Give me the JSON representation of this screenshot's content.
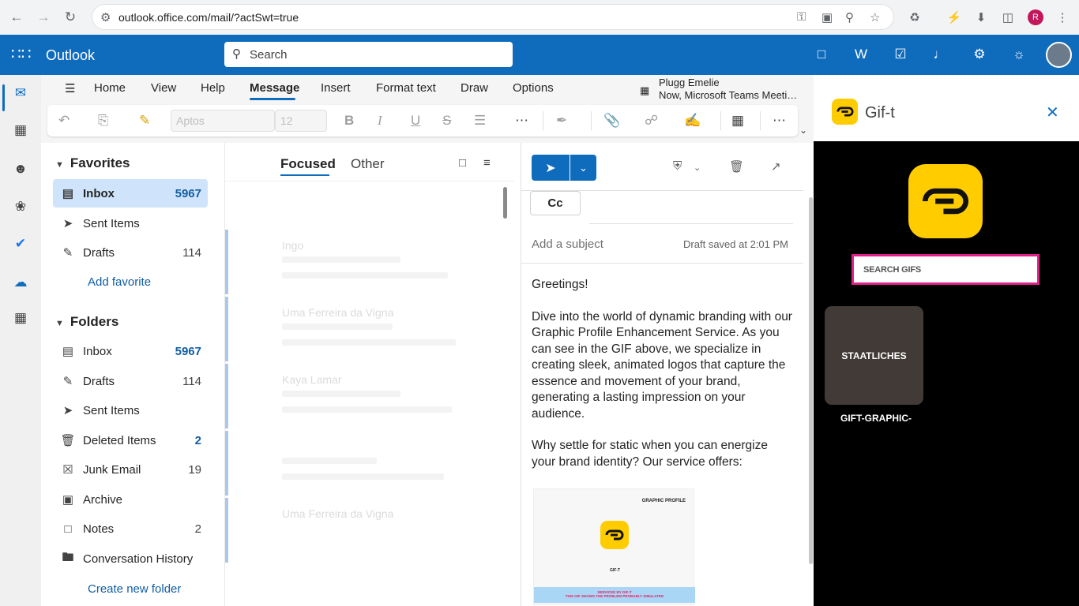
{
  "browser": {
    "url": "outlook.office.com/mail/?actSwt=true",
    "profile_initial": "R"
  },
  "app": {
    "brand": "Outlook",
    "search_placeholder": "Search"
  },
  "ribbon": {
    "tabs": [
      "Home",
      "View",
      "Help",
      "Message",
      "Insert",
      "Format text",
      "Draw",
      "Options"
    ],
    "selected_tab": "Message",
    "font_name": "Aptos",
    "font_size": "12",
    "meeting_title": "Plugg Emelie",
    "meeting_sub": "Now, Microsoft Teams Meeti…"
  },
  "folders": {
    "favorites_label": "Favorites",
    "favorites": [
      {
        "label": "Inbox",
        "count": "5967",
        "icon": "inbox-icon"
      },
      {
        "label": "Sent Items",
        "count": "",
        "icon": "send-icon"
      },
      {
        "label": "Drafts",
        "count": "114",
        "icon": "draft-icon"
      }
    ],
    "add_favorite": "Add favorite",
    "folders_label": "Folders",
    "items": [
      {
        "label": "Inbox",
        "count": "5967",
        "icon": "inbox-icon"
      },
      {
        "label": "Drafts",
        "count": "114",
        "icon": "draft-icon"
      },
      {
        "label": "Sent Items",
        "count": "",
        "icon": "send-icon"
      },
      {
        "label": "Deleted Items",
        "count": "2",
        "icon": "trash-icon"
      },
      {
        "label": "Junk Email",
        "count": "19",
        "icon": "junk-icon"
      },
      {
        "label": "Archive",
        "count": "",
        "icon": "archive-icon"
      },
      {
        "label": "Notes",
        "count": "2",
        "icon": "note-icon"
      },
      {
        "label": "Conversation History",
        "count": "",
        "icon": "folder-icon"
      }
    ],
    "create_folder": "Create new folder"
  },
  "message_list": {
    "tabs": [
      "Focused",
      "Other"
    ],
    "selected": "Focused",
    "faded_senders": [
      "Ingo",
      "Uma Ferreira da Vigna",
      "Kaya Lamar",
      "",
      "Uma Ferreira da Vigna"
    ]
  },
  "compose": {
    "cc_label": "Cc",
    "subject_placeholder": "Add a subject",
    "saved_status": "Draft saved at 2:01 PM",
    "greeting": "Greetings!",
    "paragraph1": "Dive into the world of dynamic branding with our Graphic Profile Enhancement Service. As you can see in the GIF above, we specialize in creating sleek, animated logos that capture the essence and movement of your brand, generating a lasting impression on your audience.",
    "paragraph2": "Why settle for static when you can energize your brand identity? Our service offers:",
    "embed": {
      "header": "GRAPHIC PROFILE",
      "brand": "GIF-T",
      "band_line1": "SERVICED BY GIF-T",
      "band_line2": "THIS GIF SHOWS THE PROBLEM PROBABLY SIMULATED"
    }
  },
  "addin": {
    "title": "Gif-t",
    "search_placeholder": "SEARCH GIFS",
    "tile_text": "STAATLICHES",
    "tile_label": "GIFT-GRAPHIC-",
    "accent": "#ffcc00",
    "search_border": "#e0218a"
  },
  "colors": {
    "brand_blue": "#0f6cbd",
    "selection": "#cfe4fa"
  }
}
